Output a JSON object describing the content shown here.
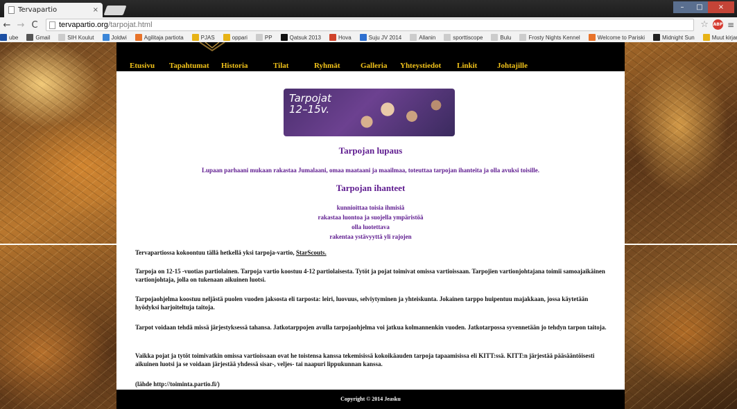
{
  "browser": {
    "tab_title": "Tervapartio",
    "tab_close": "×",
    "url_host": "tervapartio.org",
    "url_path": "/tarpojat.html",
    "nav": {
      "back": "←",
      "forward": "→",
      "reload": "C"
    },
    "star": "☆",
    "abp": "ABP",
    "menu": "≡",
    "win": {
      "min": "–",
      "max": "□",
      "close": "×"
    }
  },
  "bookmarks": [
    {
      "label": "ube",
      "color": "#1c4fa3"
    },
    {
      "label": "Gmail",
      "color": "#555555"
    },
    {
      "label": "SIH Koulut",
      "color": "#cccccc"
    },
    {
      "label": "Joldwi",
      "color": "#3b86d8"
    },
    {
      "label": "Agilitaja partiota",
      "color": "#e8732a"
    },
    {
      "label": "PJAS",
      "color": "#e7b316"
    },
    {
      "label": "oppari",
      "color": "#e7b316"
    },
    {
      "label": "PP",
      "color": "#cccccc"
    },
    {
      "label": "Qatsuk 2013",
      "color": "#111111"
    },
    {
      "label": "Hova",
      "color": "#d0432b"
    },
    {
      "label": "Suju JV 2014",
      "color": "#2d6fd0"
    },
    {
      "label": "Allanin",
      "color": "#cccccc"
    },
    {
      "label": "sporttiscope",
      "color": "#cccccc"
    },
    {
      "label": "Bulu",
      "color": "#cccccc"
    },
    {
      "label": "Frosty Nights Kennel",
      "color": "#cccccc"
    },
    {
      "label": "Welcome to Pariski",
      "color": "#e8732a"
    },
    {
      "label": "Midnight Sun",
      "color": "#222222"
    },
    {
      "label": "Muut kirjanmerkit",
      "color": "#e7b316"
    }
  ],
  "site": {
    "nav": [
      {
        "label": "Etusivu",
        "name": "nav-etusivu"
      },
      {
        "label": "Tapahtumat",
        "name": "nav-tapahtumat"
      },
      {
        "label": "Historia",
        "name": "nav-historia"
      },
      {
        "label": "Tilat",
        "name": "nav-tilat"
      },
      {
        "label": "Ryhmät",
        "name": "nav-ryhmat"
      },
      {
        "label": "Galleria",
        "name": "nav-galleria"
      },
      {
        "label": "Yhteystiedot",
        "name": "nav-yhteystiedot"
      },
      {
        "label": "Linkit",
        "name": "nav-linkit"
      },
      {
        "label": "Johtajille",
        "name": "nav-johtajille"
      }
    ],
    "banner_line1": "Tarpojat",
    "banner_line2": "12–15v.",
    "lupaus_title": "Tarpojan lupaus",
    "lupaus_text": "Lupaan parhaani mukaan rakastaa Jumalaani, omaa maataani ja maailmaa, toteuttaa tarpojan ihanteita ja olla avuksi toisille.",
    "ihanteet_title": "Tarpojan ihanteet",
    "ihanteet": [
      "kunnioittaa toisia ihmisiä",
      "rakastaa luontoa ja suojella ympäristöä",
      "olla luotettava",
      "rakentaa ystävyyttä yli rajojen"
    ],
    "intro_text": "Tervapartiossa kokoontuu tällä hetkellä yksi tarpoja-vartio, ",
    "intro_link": "StarScouts.",
    "paragraphs": [
      "Tarpoja on 12-15 -vuotias partiolainen. Tarpoja vartio koostuu 4-12 partiolaisesta. Tytöt ja pojat toimivat omissa vartioissaan. Tarpojien vartionjohtajana toimii samoajaikäinen vartionjohtaja, jolla on tukenaan aikuinen luotsi.",
      "Tarpojaohjelma koostuu neljästä puolen vuoden jaksosta eli tarposta: leiri, luovuus, selviytyminen ja yhteiskunta. Jokainen tarppo huipentuu majakkaan, jossa käytetään hyödyksi harjoiteltuja taitoja.",
      "Tarpot voidaan tehdä missä järjestyksessä tahansa. Jatkotarppojen avulla tarpojaohjelma voi jatkua kolmannenkin vuoden. Jatkotarpossa syvennetään jo tehdyn tarpon taitoja.",
      "Vaikka pojat ja tytöt toimivatkin omissa vartioissaan ovat he toistensa kanssa tekemisissä kokoikäauden tarpoja tapaamisissa eli KITT:ssä. KITT:n järjestää pääsääntöisesti aikuinen luotsi ja se voidaan järjestää yhdessä sisar-, veljes- tai naapuri lippukunnan kanssa."
    ],
    "source": "(lähde http://toiminta.partio.fi/)",
    "footer": "Copyright © 2014 Jeasku"
  }
}
